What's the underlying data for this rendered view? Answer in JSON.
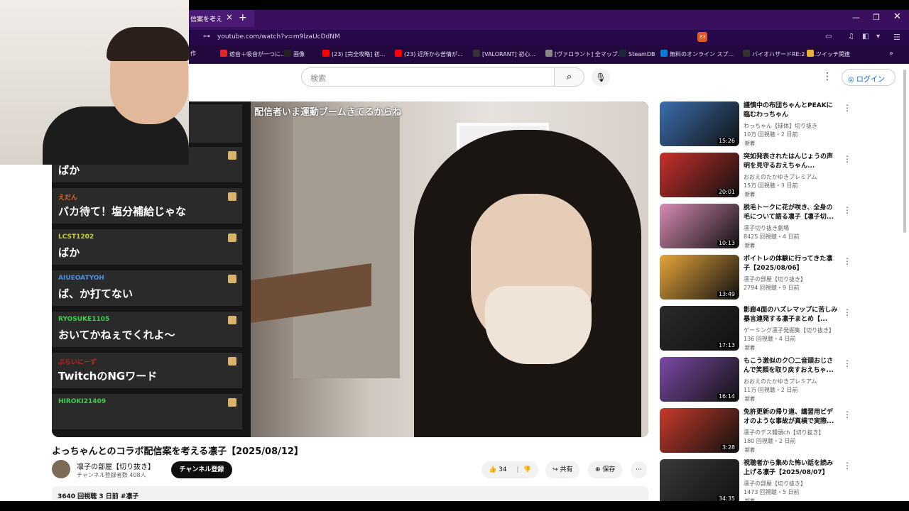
{
  "browser": {
    "tab_title": "信案を考え",
    "url": "youtube.com/watch?v=m9lzaUcDdNM",
    "bookmarks": [
      {
        "label": "遮音＋吸音が一つに...",
        "color": "#e02828"
      },
      {
        "label": "画像",
        "color": "#222"
      },
      {
        "label": "(23) [完全攻略] 初...",
        "color": "#ff0000"
      },
      {
        "label": "(23) 近所から苦情が...",
        "color": "#ff0000"
      },
      {
        "label": "[VALORANT] 初心...",
        "color": "#333"
      },
      {
        "label": "[ヴァロラント] 全マップ...",
        "color": "#888"
      },
      {
        "label": "SteamDB",
        "color": "#1b2838"
      },
      {
        "label": "無料のオンライン スプ...",
        "color": "#0a7cd8"
      },
      {
        "label": "バイオハザードRE:2 全...",
        "color": "#333"
      },
      {
        "label": "ツイッチ関連",
        "color": "#e8b23a"
      }
    ],
    "bm_x": [
      310,
      400,
      454,
      556,
      666,
      768,
      872,
      930,
      1046,
      1136
    ],
    "badge_count": "23",
    "left_cut": "作"
  },
  "youtube": {
    "search_placeholder": "検索",
    "login_label": "ログイン"
  },
  "video": {
    "subtitle": "配信者いま運動ブームきてるからね",
    "chat": [
      {
        "user": "",
        "message": "ばか",
        "color": "#888"
      },
      {
        "user": "えだん",
        "message": "バカ待て！塩分補給じゃな",
        "color": "#e0672c"
      },
      {
        "user": "LCST1202",
        "message": "ばか",
        "color": "#c9d13a"
      },
      {
        "user": "AIUEOATYOH",
        "message": "ば、か打てない",
        "color": "#4b8fe0"
      },
      {
        "user": "RYOSUKE1105",
        "message": "おいてかねぇでくれよ〜",
        "color": "#3ccf4c"
      },
      {
        "user": "ぶらいにーず",
        "message": "TwitchのNGワード",
        "color": "#cc1f1f"
      },
      {
        "user": "HIROKI21409",
        "message": "",
        "color": "#3ccf4c"
      }
    ],
    "title": "よっちゃんとのコラボ配信案を考える凛子【2025/08/12】",
    "channel": "凛子の部屋【切り抜き】",
    "subscribers": "チャンネル登録者数 408人",
    "subscribe_label": "チャンネル登録",
    "likes": "34",
    "share_label": "共有",
    "save_label": "保存",
    "description": "3640 回視聴  3 日前  #凛子"
  },
  "recommendations": [
    {
      "title": "謹慎中の布団ちゃんとPEAKに臨むわっちゃん",
      "channel": "わっちゃん【球体】切り抜き",
      "meta": "10万 回視聴・2 日前",
      "duration": "15:26",
      "badge": "新着",
      "thumb": "#3b6fb0"
    },
    {
      "title": "突如発表されたはんじょうの声明を見守るおえちゃん...",
      "channel": "おおえのたかゆきプレミアム",
      "meta": "15万 回視聴・3 日前",
      "duration": "20:01",
      "badge": "新着",
      "thumb": "#c9302c"
    },
    {
      "title": "脱毛トークに花が咲き、全身の毛について語る凛子【凛子切...",
      "channel": "凛子切り抜き劇場",
      "meta": "8425 回視聴・4 日前",
      "duration": "10:13",
      "badge": "新着",
      "thumb": "#d88ab4"
    },
    {
      "title": "ボイトレの体験に行ってきた凛子【2025/08/06】",
      "channel": "凛子の部屋【切り抜き】",
      "meta": "2794 回視聴・9 日前",
      "duration": "13:49",
      "badge": "",
      "thumb": "#e6a43a"
    },
    {
      "title": "影廊4面のハズレマップに苦しみ暴言連発する凛子まとめ【...",
      "channel": "ゲーミング凛子発掘集【切り抜き】",
      "meta": "136 回視聴・4 日前",
      "duration": "17:13",
      "badge": "新着",
      "thumb": "#2a2a2a"
    },
    {
      "title": "もこう激似のク〇二音頭おじさんで笑顔を取り戻すおえちゃ...",
      "channel": "おおえのたかゆきプレミアム",
      "meta": "11万 回視聴・2 日前",
      "duration": "16:14",
      "badge": "新着",
      "thumb": "#7c4aa8"
    },
    {
      "title": "免許更新の帰り道、講習用ビデオのような事故が真横で実際...",
      "channel": "凛子のデス饅頭ch【切り抜き】",
      "meta": "180 回視聴・2 日前",
      "duration": "3:28",
      "badge": "新着",
      "thumb": "#c83a2a"
    },
    {
      "title": "視聴者から集めた怖い話を読み上げる凛子【2025/08/07】",
      "channel": "凛子の部屋【切り抜き】",
      "meta": "1473 回視聴・5 日前",
      "duration": "34:35",
      "badge": "新着",
      "thumb": "#3a3a3a"
    }
  ]
}
